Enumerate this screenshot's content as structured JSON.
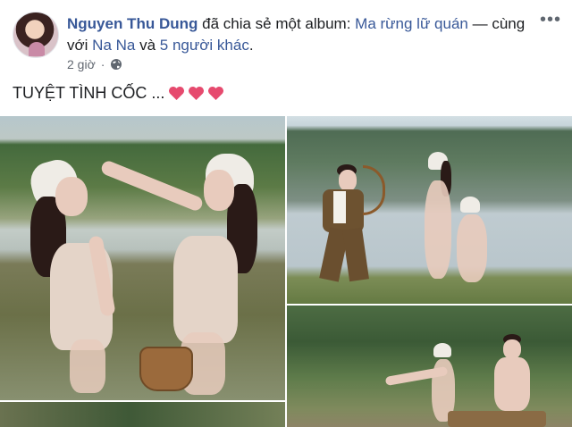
{
  "post": {
    "author": "Nguyen Thu Dung",
    "shared_text": "đã chia sẻ một album:",
    "album_name": "Ma rừng lữ quán",
    "with_text": "— cùng với",
    "tagged_friend": "Na Na",
    "and_text": "và",
    "others": "5 người khác",
    "period": ".",
    "time": "2 giờ",
    "dot": "·",
    "caption": "TUYỆT TÌNH CỐC ...",
    "more_button": "•••"
  },
  "icons": {
    "privacy": "globe-icon",
    "more": "more-options-icon",
    "caption_emoji": "heart-icon",
    "heart_color": "#e64a6e"
  },
  "colors": {
    "link": "#385898",
    "text": "#1c1e21",
    "meta": "#616770"
  }
}
